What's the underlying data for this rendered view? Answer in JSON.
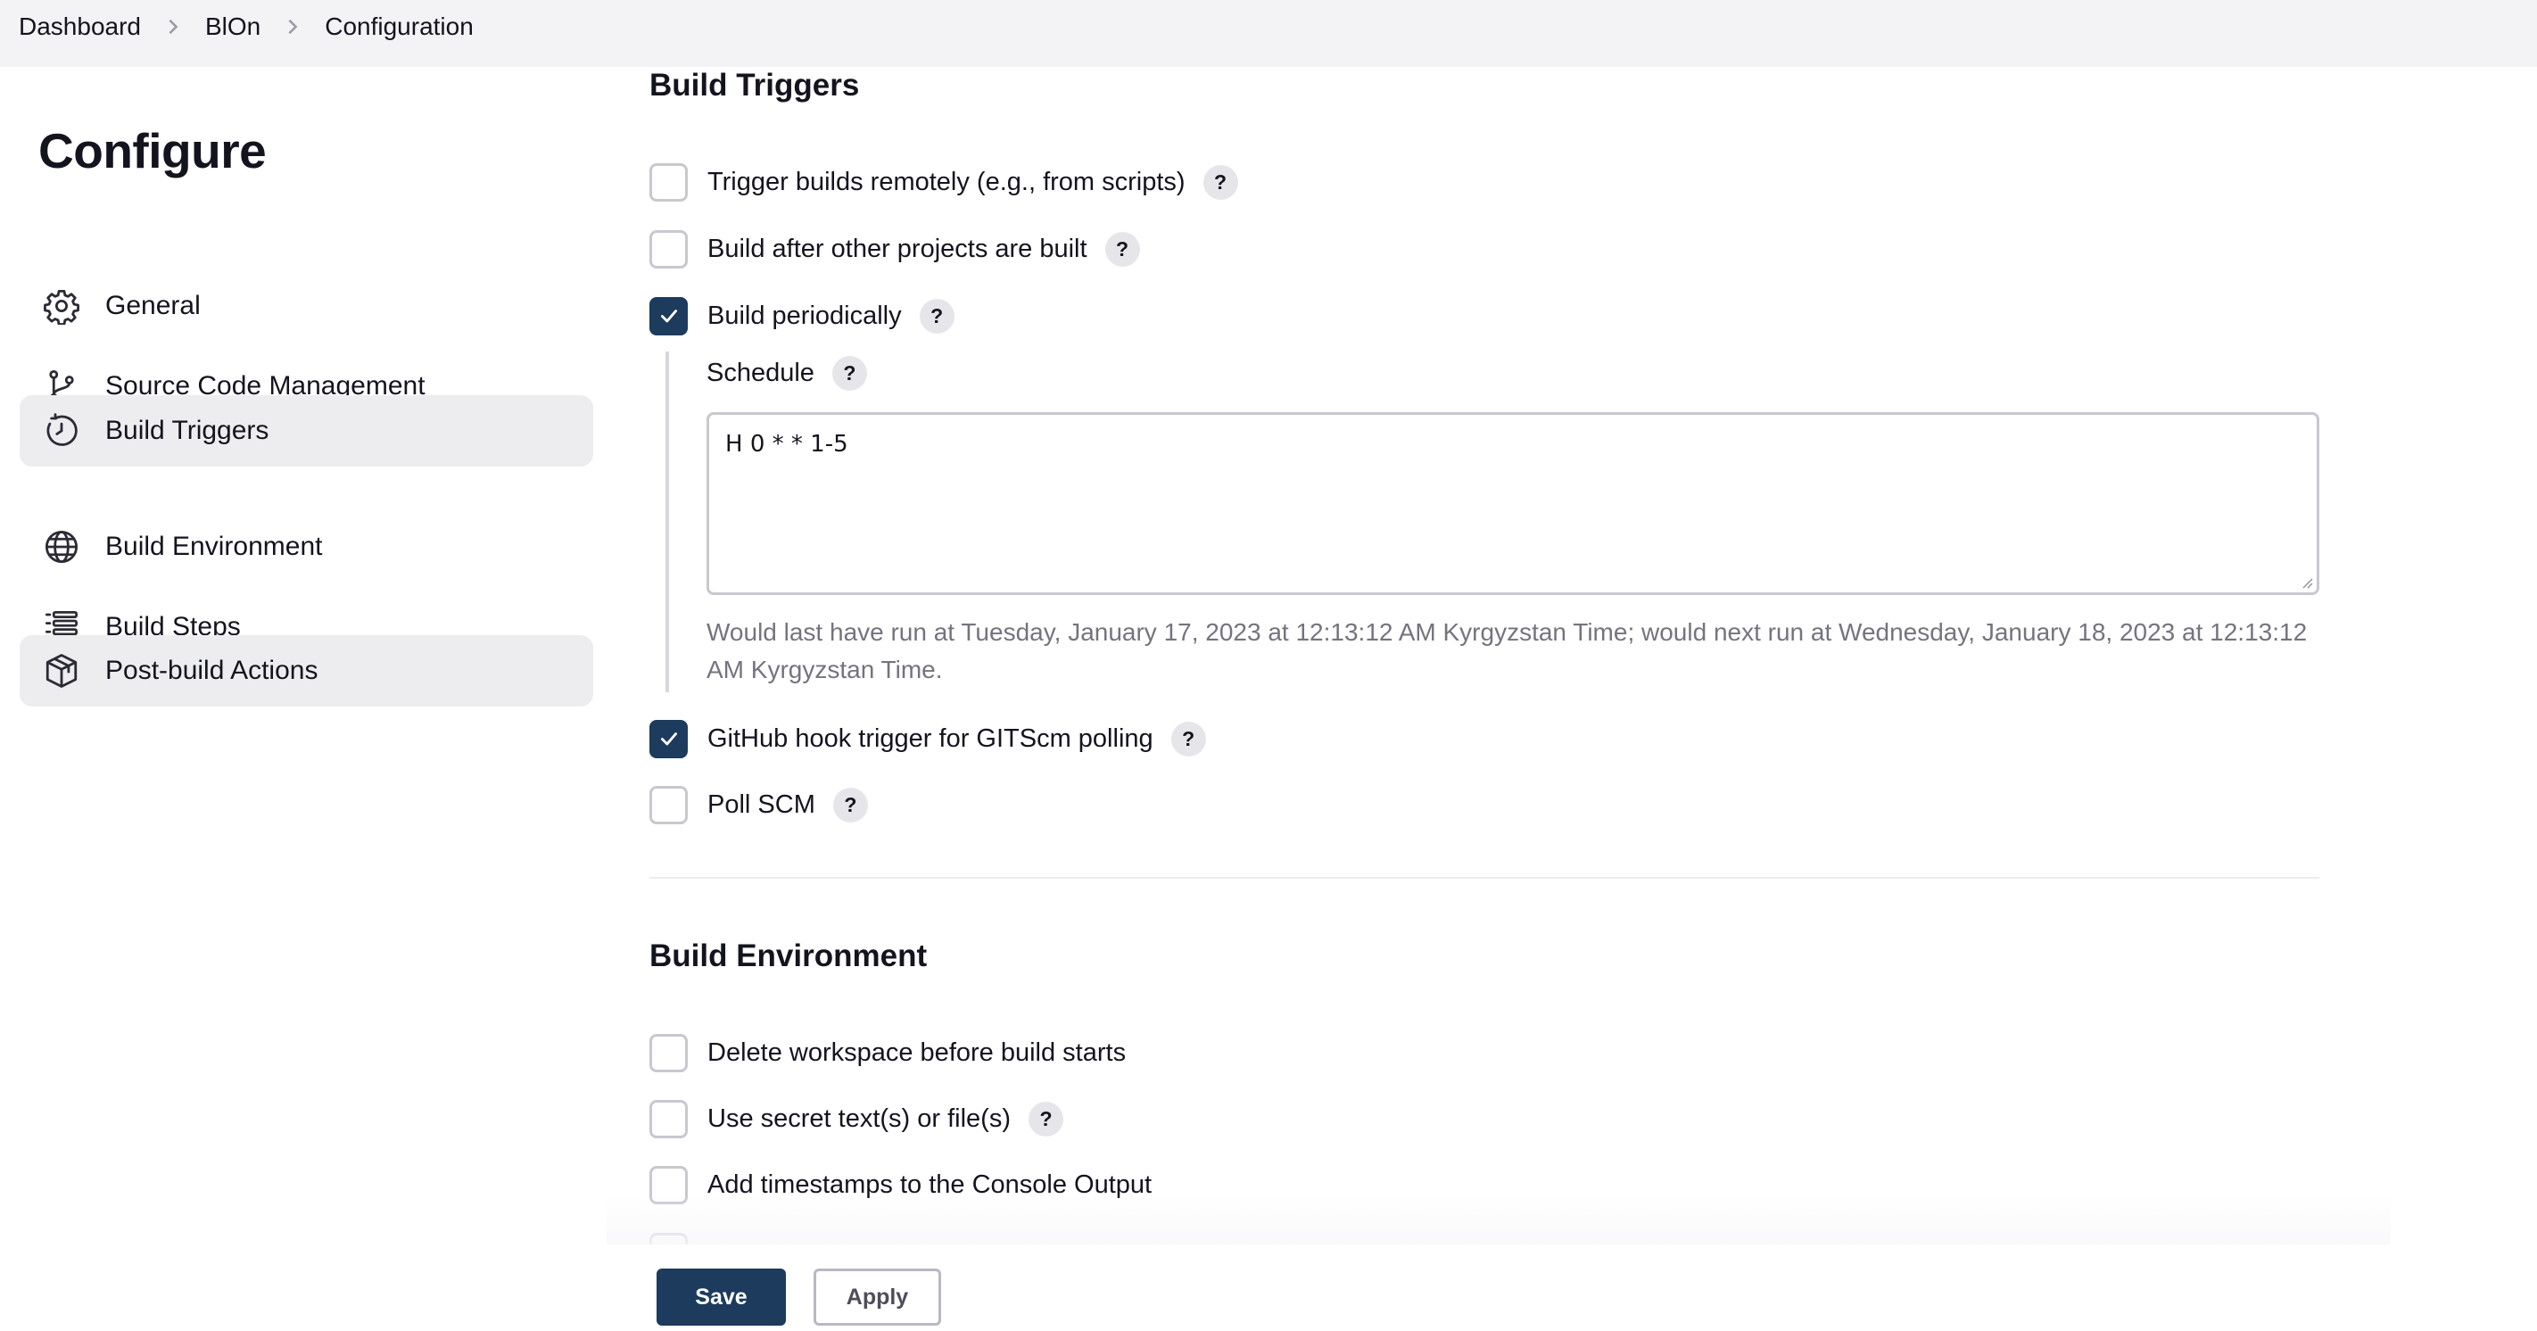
{
  "breadcrumb": {
    "items": [
      "Dashboard",
      "BlOn",
      "Configuration"
    ]
  },
  "sidebar": {
    "title": "Configure",
    "items": [
      {
        "label": "General",
        "icon": "gear-icon"
      },
      {
        "label": "Source Code Management",
        "icon": "branch-icon"
      },
      {
        "label": "Build Triggers",
        "icon": "clock-icon",
        "active": true
      },
      {
        "label": "Build Environment",
        "icon": "globe-icon"
      },
      {
        "label": "Build Steps",
        "icon": "list-icon"
      },
      {
        "label": "Post-build Actions",
        "icon": "package-icon",
        "active": true
      }
    ]
  },
  "build_triggers": {
    "title": "Build Triggers",
    "options": [
      {
        "label": "Trigger builds remotely (e.g., from scripts)",
        "checked": false,
        "help": "?"
      },
      {
        "label": "Build after other projects are built",
        "checked": false,
        "help": "?"
      },
      {
        "label": "Build periodically",
        "checked": true,
        "help": "?"
      },
      {
        "label": "GitHub hook trigger for GITScm polling",
        "checked": true,
        "help": "?"
      },
      {
        "label": "Poll SCM",
        "checked": false,
        "help": "?"
      }
    ],
    "schedule": {
      "label": "Schedule",
      "help": "?",
      "value": "H 0 * * 1-5",
      "note": "Would last have run at Tuesday, January 17, 2023 at 12:13:12 AM Kyrgyzstan Time; would next run at Wednesday, January 18, 2023 at 12:13:12 AM Kyrgyzstan Time."
    }
  },
  "build_environment": {
    "title": "Build Environment",
    "options": [
      {
        "label": "Delete workspace before build starts",
        "checked": false
      },
      {
        "label": "Use secret text(s) or file(s)",
        "checked": false,
        "help": "?"
      },
      {
        "label": "Add timestamps to the Console Output",
        "checked": false
      }
    ]
  },
  "footer": {
    "save_label": "Save",
    "apply_label": "Apply"
  },
  "colors": {
    "primary": "#1d3b5c",
    "topbar_bg": "#f3f3f5",
    "active_nav_bg": "#ededf0",
    "muted_text": "#74747e"
  }
}
